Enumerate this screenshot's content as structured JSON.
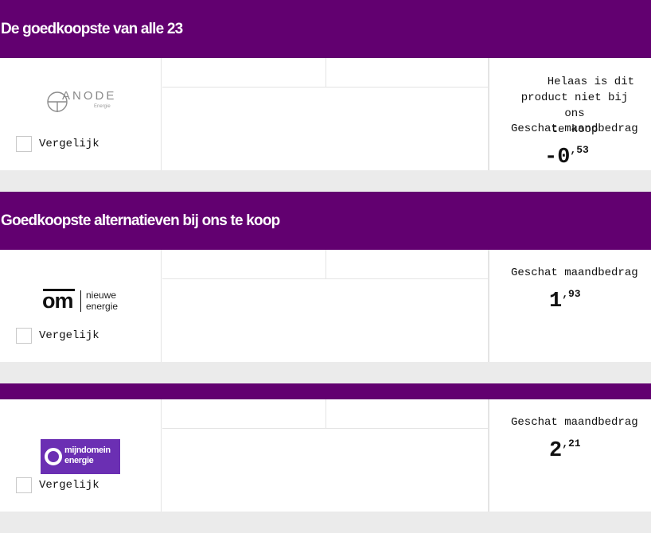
{
  "sections": [
    {
      "title": "De goedkoopste van alle 23",
      "card": {
        "logo_alt": "ANODE Energie",
        "logo_text": "ANODE",
        "logo_sub": "Energie",
        "compare_label": "Vergelijk",
        "unavailable_lines": [
          "Helaas is dit",
          "product niet bij ons",
          "te koop"
        ],
        "estimate_label": "Geschat maandbedrag",
        "price_int": "-0",
        "price_cents": ",53"
      }
    },
    {
      "title": "Goedkoopste alternatieven bij ons te koop",
      "card": {
        "logo_alt": "om nieuwe energie",
        "logo_text": "om",
        "logo_sub_1": "nieuwe",
        "logo_sub_2": "energie",
        "compare_label": "Vergelijk",
        "estimate_label": "Geschat maandbedrag",
        "price_int": "1",
        "price_cents": ",93"
      }
    },
    {
      "title": "",
      "card": {
        "logo_alt": "mijndomein energie",
        "logo_text_1": "mijndomein",
        "logo_text_2": "energie",
        "compare_label": "Vergelijk",
        "estimate_label": "Geschat maandbedrag",
        "price_int": "2",
        "price_cents": ",21"
      }
    }
  ],
  "colors": {
    "header": "#620070",
    "mijndomein": "#6b2fb3",
    "background": "#ebebeb"
  }
}
